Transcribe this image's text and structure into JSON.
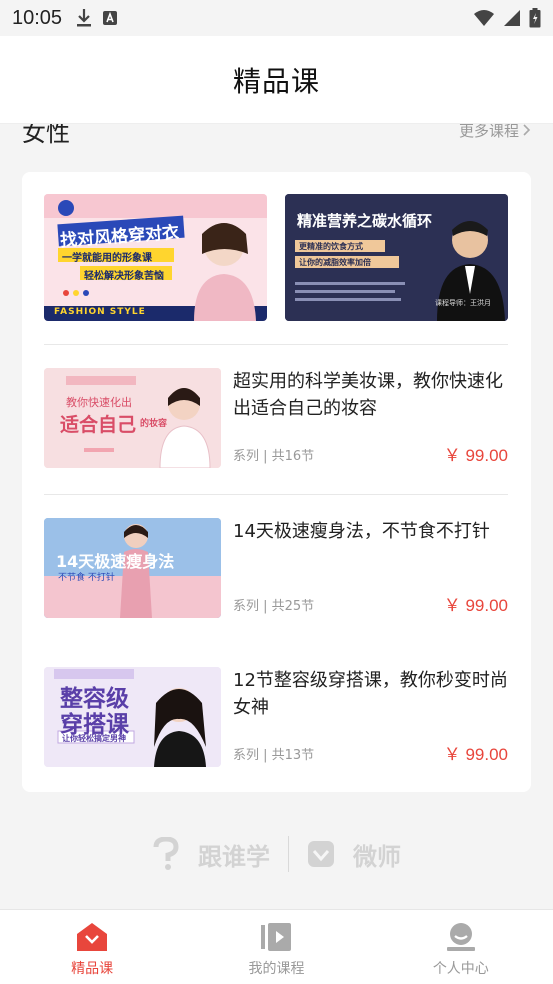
{
  "status_bar": {
    "time": "10:05"
  },
  "header": {
    "title": "精品课"
  },
  "section": {
    "title": "女性",
    "more_label": "更多课程"
  },
  "banners": [
    {
      "line1": "找对风格穿对衣",
      "line2": "一学就能用的形象课",
      "line3": "轻松解决形象苦恼",
      "tag": "FASHION STYLE"
    },
    {
      "line1": "精准营养之碳水循环",
      "line2": "更精准的饮食方式",
      "line3": "让你的减脂效率加倍",
      "tag": "课程导师：王洪月"
    }
  ],
  "courses": [
    {
      "title": "超实用的科学美妆课，教你快速化出适合自己的妆容",
      "meta": "系列 | 共16节",
      "price": "￥ 99.00",
      "thumb_text1": "教你快速化出",
      "thumb_text2": "适合自己",
      "thumb_text3": "的妆容"
    },
    {
      "title": "14天极速瘦身法，不节食不打针",
      "meta": "系列 | 共25节",
      "price": "￥ 99.00",
      "thumb_text1": "14天极速瘦身法",
      "thumb_text2": "不节食 不打针",
      "thumb_text3": ""
    },
    {
      "title": "12节整容级穿搭课，教你秒变时尚女神",
      "meta": "系列 | 共13节",
      "price": "￥ 99.00",
      "thumb_text1": "整容级",
      "thumb_text2": "穿搭课",
      "thumb_text3": "让你轻松搞定男神"
    }
  ],
  "footer": {
    "logo1": "跟谁学",
    "logo2": "微师"
  },
  "tabbar": {
    "tabs": [
      {
        "label": "精品课",
        "icon": "home-icon",
        "active": true
      },
      {
        "label": "我的课程",
        "icon": "play-icon",
        "active": false
      },
      {
        "label": "个人中心",
        "icon": "user-icon",
        "active": false
      }
    ]
  },
  "colors": {
    "accent": "#e8463c",
    "background": "#f4f4f4"
  }
}
